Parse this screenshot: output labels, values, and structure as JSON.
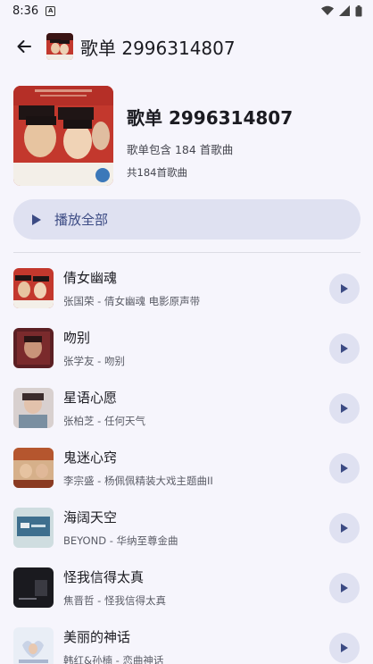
{
  "status_bar": {
    "time": "8:36",
    "notification_icon": "A"
  },
  "app_bar": {
    "title": "歌单 2996314807",
    "back_icon": "arrow-back-icon"
  },
  "header": {
    "title": "歌单 2996314807",
    "subtitle": "歌单包含 184 首歌曲",
    "count": "共184首歌曲"
  },
  "play_all": {
    "label": "播放全部",
    "icon": "play-icon"
  },
  "songs": [
    {
      "title": "倩女幽魂",
      "subtitle": "张国荣 - 倩女幽魂 电影原声带",
      "thumb_color": "#6b1d1d"
    },
    {
      "title": "吻别",
      "subtitle": "张学友 - 吻别",
      "thumb_color": "#5b1f23"
    },
    {
      "title": "星语心愿",
      "subtitle": "张柏芝 - 任何天气",
      "thumb_color": "#9c8f95"
    },
    {
      "title": "鬼迷心窍",
      "subtitle": "李宗盛 - 杨佩佩精装大戏主题曲II",
      "thumb_color": "#b5562e"
    },
    {
      "title": "海阔天空",
      "subtitle": "BEYOND - 华纳至尊金曲",
      "thumb_color": "#3e6f8e"
    },
    {
      "title": "怪我信得太真",
      "subtitle": "焦晋哲 - 怪我信得太真",
      "thumb_color": "#1a1a1f"
    },
    {
      "title": "美丽的神话",
      "subtitle": "韩红&孙楠 - 恋曲神话",
      "thumb_color": "#c9d3e6"
    }
  ],
  "colors": {
    "accent": "#3c4b84",
    "tonal_bg": "#dfe1f1",
    "background": "#f6f5fc"
  }
}
